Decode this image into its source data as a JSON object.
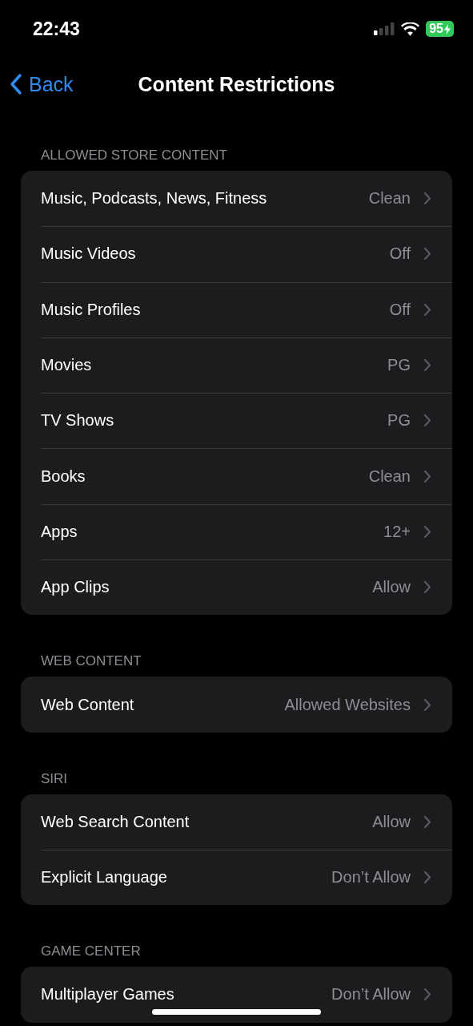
{
  "status_bar": {
    "time": "22:43",
    "battery": "95"
  },
  "nav": {
    "back": "Back",
    "title": "Content Restrictions"
  },
  "sections": [
    {
      "header": "ALLOWED STORE CONTENT",
      "rows": [
        {
          "label": "Music, Podcasts, News, Fitness",
          "value": "Clean"
        },
        {
          "label": "Music Videos",
          "value": "Off"
        },
        {
          "label": "Music Profiles",
          "value": "Off"
        },
        {
          "label": "Movies",
          "value": "PG"
        },
        {
          "label": "TV Shows",
          "value": "PG"
        },
        {
          "label": "Books",
          "value": "Clean"
        },
        {
          "label": "Apps",
          "value": "12+"
        },
        {
          "label": "App Clips",
          "value": "Allow"
        }
      ]
    },
    {
      "header": "WEB CONTENT",
      "rows": [
        {
          "label": "Web Content",
          "value": "Allowed Websites"
        }
      ]
    },
    {
      "header": "SIRI",
      "rows": [
        {
          "label": "Web Search Content",
          "value": "Allow"
        },
        {
          "label": "Explicit Language",
          "value": "Don’t Allow"
        }
      ]
    },
    {
      "header": "GAME CENTER",
      "rows": [
        {
          "label": "Multiplayer Games",
          "value": "Don’t Allow"
        }
      ]
    }
  ]
}
